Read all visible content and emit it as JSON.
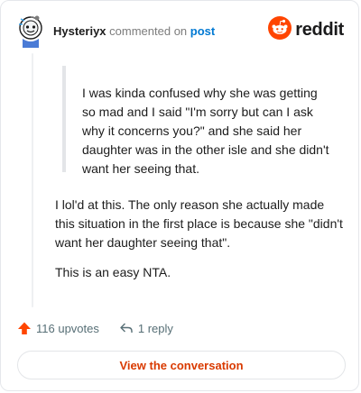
{
  "header": {
    "author": "Hysteriyx",
    "action_text": "commented on",
    "post_link": "post",
    "brand": "reddit",
    "avatar_icon": "snoo-avatar-icon",
    "brand_icon": "reddit-logo-icon",
    "brand_color": "#ff4500"
  },
  "comment": {
    "quote": "I was kinda confused why she was getting so mad and I said \"I'm sorry but can I ask why it concerns you?\" and she said her daughter was in the other isle and she didn't want her seeing that.",
    "paragraphs": [
      "I lol'd at this. The only reason she actually made this situation in the first place is because she \"didn't want her daughter seeing that\".",
      "This is an easy NTA."
    ]
  },
  "actions": {
    "upvotes_label": "116 upvotes",
    "reply_label": "1 reply",
    "upvote_icon": "upvote-arrow-icon",
    "reply_icon": "reply-arrow-icon"
  },
  "footer": {
    "button_label": "View the conversation",
    "accent_color": "#d93a00"
  }
}
